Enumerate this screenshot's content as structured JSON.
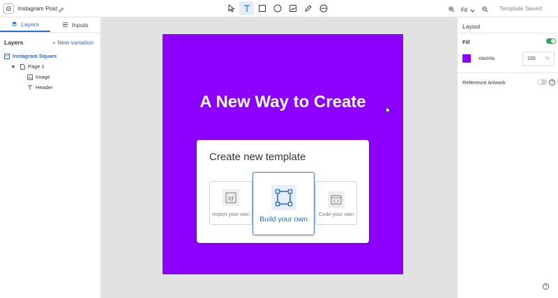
{
  "topbar": {
    "doc_title": "Instagram Post",
    "zoom_label": "Fit",
    "save_status": "Template Saved"
  },
  "left_panel": {
    "tabs": [
      {
        "label": "Layers",
        "icon": "layers-icon",
        "active": true
      },
      {
        "label": "Inputs",
        "icon": "list-icon",
        "active": false
      }
    ],
    "heading": "Layers",
    "new_variation": "+ New variation",
    "tree": [
      {
        "label": "Instagram Square",
        "icon": "artboard-icon",
        "level": 0
      },
      {
        "label": "Page 1",
        "icon": "page-icon",
        "level": 1
      },
      {
        "label": "Image",
        "icon": "image-icon",
        "level": 2
      },
      {
        "label": "Header",
        "icon": "text-icon",
        "level": 2
      }
    ]
  },
  "canvas": {
    "headline": "A New Way to Create",
    "card": {
      "title": "Create new template",
      "options": [
        {
          "label": "Import your own",
          "icon": "indesign-icon"
        },
        {
          "label": "Build your own",
          "icon": "frame-icon",
          "selected": true
        },
        {
          "label": "Code your own",
          "icon": "code-icon"
        }
      ]
    }
  },
  "right_panel": {
    "title": "Layout",
    "fill_label": "Fill",
    "fill_enabled": true,
    "fill_color": "#8b00fe",
    "fill_hex_label": "#8b00fe",
    "opacity_value": "100",
    "opacity_unit": "%",
    "reference_label": "Reference Artwork",
    "reference_enabled": false
  },
  "colors": {
    "accent": "#2b6cd4",
    "artboard": "#8b00fe",
    "toggle_on": "#2fa84f"
  }
}
